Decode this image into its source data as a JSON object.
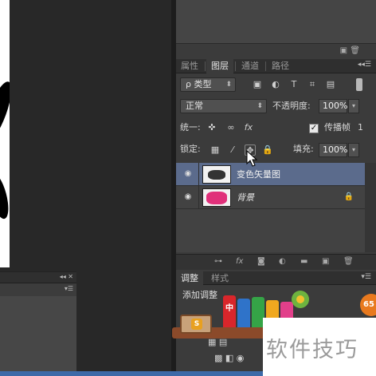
{
  "layers_panel": {
    "tabs": [
      "属性",
      "图层",
      "通道",
      "路径"
    ],
    "active_tab": "图层",
    "filter_kind": "ρ 类型",
    "blend_mode": "正常",
    "opacity_label": "不透明度:",
    "opacity_value": "100%",
    "unify_label": "统一:",
    "fx_label": "fx",
    "propagate_label": "传播帧",
    "propagate_value": "1",
    "propagate_checked": true,
    "lock_label": "锁定:",
    "fill_label": "填充:",
    "fill_value": "100%",
    "layers": [
      {
        "name": "变色矢量图",
        "selected": true,
        "visible": true,
        "locked": false
      },
      {
        "name": "背景",
        "selected": false,
        "visible": true,
        "locked": true
      }
    ],
    "bottom_toolbar_fx": "fx"
  },
  "adjustments_panel": {
    "tabs": [
      "调整",
      "样式"
    ],
    "active_tab": "调整",
    "title": "添加调整"
  },
  "overlay": {
    "shelf_book_char": "中",
    "chest_char": "S",
    "badge_text": "65",
    "watermark": "软件技巧"
  },
  "colors": {
    "selected_layer": "#5b6b8c",
    "panel_bg": "#3b3b3b",
    "accent_badge": "#e8791e"
  }
}
